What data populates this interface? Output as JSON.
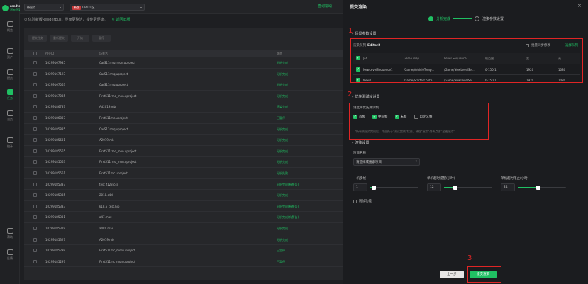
{
  "app": {
    "logo_line1": "rendterbus",
    "logo_line2": "渲云渲染"
  },
  "nav": [
    {
      "label": "概览"
    },
    {
      "label": "资产"
    },
    {
      "label": "提交"
    },
    {
      "label": "任务"
    },
    {
      "label": "渲染"
    },
    {
      "label": "统计"
    },
    {
      "label": "帮助"
    },
    {
      "label": "反馈"
    }
  ],
  "topbar": {
    "project_select": "待渲染",
    "gpu_tag": "新版",
    "gpu_select": "GPU 1 区",
    "right_label": "查询帮助"
  },
  "notice": {
    "text": "体验新版Renderbus，界面更整洁，操作更便捷。",
    "link": "↻ 返回旧版"
  },
  "toolbar": [
    "提交任务",
    "重新提交",
    "开始",
    "暂停"
  ],
  "list": {
    "headers": [
      "作业ID",
      "场景名",
      "状态"
    ],
    "rows": [
      {
        "id": "10299167935",
        "scene": "CarS11rmq_mon.uproject",
        "status": "分析完成"
      },
      {
        "id": "10299167193",
        "scene": "CarS11rmq.uproject",
        "status": "分析完成"
      },
      {
        "id": "10299167063",
        "scene": "CarS11rmq.uproject",
        "status": "分析完成"
      },
      {
        "id": "10299167035",
        "scene": "First511rmc_mon.uproject",
        "status": "分析完成"
      },
      {
        "id": "10299186787",
        "scene": "Ad2019.mb",
        "status": "渲染完成"
      },
      {
        "id": "10299186887",
        "scene": "First511mc.uproject",
        "status": "已暂停"
      },
      {
        "id": "10299185885",
        "scene": "CarS11rmq.uproject",
        "status": "分析完成"
      },
      {
        "id": "10299185631",
        "scene": "A2019.mb",
        "status": "分析完成"
      },
      {
        "id": "10299185565",
        "scene": "First511rmc_mon.uproject",
        "status": "分析完成"
      },
      {
        "id": "10299185563",
        "scene": "First511rmc_mon.uproject",
        "status": "分析完成"
      },
      {
        "id": "10299185561",
        "scene": "First511mc.uproject",
        "status": "分析失败"
      },
      {
        "id": "10299185337",
        "scene": "test_f123.c4d",
        "status": "分析完成(有警告)"
      },
      {
        "id": "10299185335",
        "scene": "2018.c4d",
        "status": "分析完成"
      },
      {
        "id": "10299185333",
        "scene": "k18.5_test.hip",
        "status": "分析完成(有警告)"
      },
      {
        "id": "10299185331",
        "scene": "a47.max",
        "status": "分析完成(有警告)"
      },
      {
        "id": "10299185329",
        "scene": "a481.max",
        "status": "分析完成"
      },
      {
        "id": "10299185327",
        "scene": "A2019.mb",
        "status": "分析完成"
      },
      {
        "id": "10299185299",
        "scene": "First511mc_mon.uproject",
        "status": "已暂停"
      },
      {
        "id": "10299185297",
        "scene": "First511mc_mon.uproject",
        "status": "已暂停"
      }
    ]
  },
  "panel": {
    "title": "提交渲染",
    "close": "×",
    "step1": "分析完成",
    "step2": "渲染参数设置",
    "section1": "场景参数设置",
    "queue_label": "渲染队列",
    "queue_value": "Editor2",
    "sync_label": "批量同步修改",
    "queue_link": "选择队列",
    "job_headers": [
      "Job",
      "Game map",
      "Level Sequence",
      "帧范围",
      "宽",
      "高"
    ],
    "jobs": [
      {
        "job": "NewLevelSequence1",
        "map": "/Game/VehicleTemp...",
        "seq": "/Game/NewLevelSe...",
        "frames": "0-150[1]",
        "width": "1920",
        "height": "1080"
      },
      {
        "job": "New2",
        "map": "/Game/StarterConte...",
        "seq": "/Game/NewLevelSe...",
        "frames": "0-150[1]",
        "width": "1920",
        "height": "1080"
      }
    ],
    "section2": "优先测试帧设置",
    "frames_title": "请选择优先测试帧",
    "frame_opts": [
      {
        "label": "首帧",
        "checked": true
      },
      {
        "label": "中间帧",
        "checked": true
      },
      {
        "label": "末帧",
        "checked": true
      },
      {
        "label": "自定义帧",
        "checked": false
      }
    ],
    "frames_hint": "*所有帧渲染完成后，作业处于\"测试完成\"状态，请在\"渲染\"列表点击\"全速渲染\"",
    "section3": "渲染设置",
    "project_label": "项目名称",
    "project_placeholder": "请选择或搜索项目",
    "machines_label": "一机多帧",
    "machines_value": "1",
    "timeout_label": "单机超时提醒(小时)",
    "timeout_value": "12",
    "stop_label": "单机超时停止(小时)",
    "stop_value": "24",
    "extra_label": "附加功能",
    "prev_btn": "上一步",
    "submit_btn": "提交渲染",
    "marks": [
      "1",
      "2",
      "3"
    ]
  }
}
